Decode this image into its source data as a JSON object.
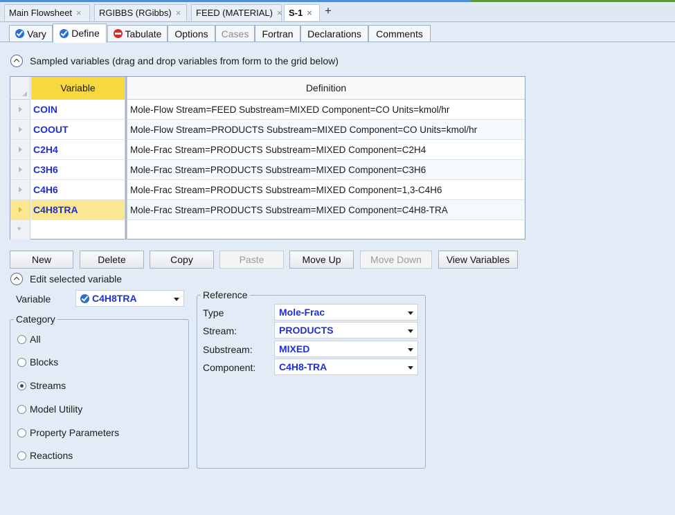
{
  "doc_tabs": [
    {
      "label": "Main Flowsheet",
      "active": false
    },
    {
      "label": "RGIBBS (RGibbs)",
      "active": false
    },
    {
      "label": "FEED (MATERIAL)",
      "active": false
    },
    {
      "label": "S-1",
      "active": true
    }
  ],
  "doc_tab_close": "×",
  "add_tab": "+",
  "sub_tabs": [
    {
      "label": "Vary",
      "icon": "check-icon"
    },
    {
      "label": "Define",
      "icon": "check-icon",
      "active": true
    },
    {
      "label": "Tabulate",
      "icon": "stop-icon"
    },
    {
      "label": "Options"
    },
    {
      "label": "Cases",
      "disabled": true
    },
    {
      "label": "Fortran"
    },
    {
      "label": "Declarations"
    },
    {
      "label": "Comments"
    }
  ],
  "sampled_section": {
    "title": "Sampled variables (drag and drop variables from form to the grid below)"
  },
  "grid": {
    "headers": {
      "variable": "Variable",
      "definition": "Definition"
    },
    "rows": [
      {
        "variable": "COIN",
        "definition": "Mole-Flow Stream=FEED Substream=MIXED Component=CO Units=kmol/hr"
      },
      {
        "variable": "COOUT",
        "definition": "Mole-Flow Stream=PRODUCTS Substream=MIXED Component=CO Units=kmol/hr"
      },
      {
        "variable": "C2H4",
        "definition": "Mole-Frac Stream=PRODUCTS Substream=MIXED Component=C2H4"
      },
      {
        "variable": "C3H6",
        "definition": "Mole-Frac Stream=PRODUCTS Substream=MIXED Component=C3H6"
      },
      {
        "variable": "C4H6",
        "definition": "Mole-Frac Stream=PRODUCTS Substream=MIXED Component=1,3-C4H6"
      },
      {
        "variable": "C4H8TRA",
        "definition": "Mole-Frac Stream=PRODUCTS Substream=MIXED Component=C4H8-TRA",
        "selected": true
      }
    ]
  },
  "buttons": {
    "new": "New",
    "delete": "Delete",
    "copy": "Copy",
    "paste": "Paste",
    "move_up": "Move Up",
    "move_down": "Move Down",
    "view_variables": "View Variables"
  },
  "edit_section": {
    "title": "Edit selected variable",
    "variable_label": "Variable",
    "variable_value": "C4H8TRA"
  },
  "category": {
    "legend": "Category",
    "options": [
      "All",
      "Blocks",
      "Streams",
      "Model Utility",
      "Property Parameters",
      "Reactions"
    ],
    "selected": "Streams"
  },
  "reference": {
    "legend": "Reference",
    "fields": [
      {
        "label": "Type",
        "value": "Mole-Frac"
      },
      {
        "label": "Stream:",
        "value": "PRODUCTS"
      },
      {
        "label": "Substream:",
        "value": "MIXED"
      },
      {
        "label": "Component:",
        "value": "C4H8-TRA"
      }
    ]
  },
  "colors": {
    "accent_header": "#f8d83f",
    "variable_text": "#1f2fd6",
    "background": "#e3ecf6"
  }
}
